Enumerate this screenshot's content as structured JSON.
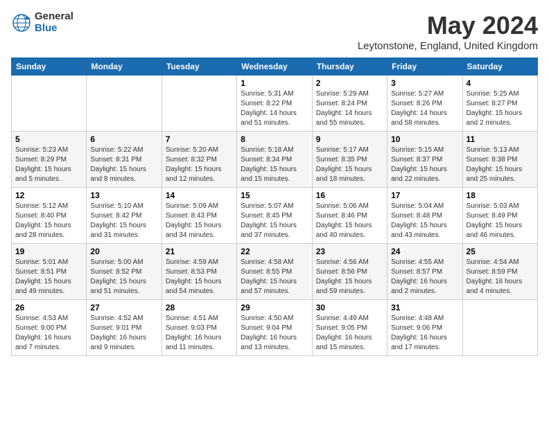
{
  "logo": {
    "general": "General",
    "blue": "Blue"
  },
  "title": {
    "month_year": "May 2024",
    "location": "Leytonstone, England, United Kingdom"
  },
  "headers": [
    "Sunday",
    "Monday",
    "Tuesday",
    "Wednesday",
    "Thursday",
    "Friday",
    "Saturday"
  ],
  "weeks": [
    [
      {
        "day": "",
        "info": ""
      },
      {
        "day": "",
        "info": ""
      },
      {
        "day": "",
        "info": ""
      },
      {
        "day": "1",
        "info": "Sunrise: 5:31 AM\nSunset: 8:22 PM\nDaylight: 14 hours\nand 51 minutes."
      },
      {
        "day": "2",
        "info": "Sunrise: 5:29 AM\nSunset: 8:24 PM\nDaylight: 14 hours\nand 55 minutes."
      },
      {
        "day": "3",
        "info": "Sunrise: 5:27 AM\nSunset: 8:26 PM\nDaylight: 14 hours\nand 58 minutes."
      },
      {
        "day": "4",
        "info": "Sunrise: 5:25 AM\nSunset: 8:27 PM\nDaylight: 15 hours\nand 2 minutes."
      }
    ],
    [
      {
        "day": "5",
        "info": "Sunrise: 5:23 AM\nSunset: 8:29 PM\nDaylight: 15 hours\nand 5 minutes."
      },
      {
        "day": "6",
        "info": "Sunrise: 5:22 AM\nSunset: 8:31 PM\nDaylight: 15 hours\nand 8 minutes."
      },
      {
        "day": "7",
        "info": "Sunrise: 5:20 AM\nSunset: 8:32 PM\nDaylight: 15 hours\nand 12 minutes."
      },
      {
        "day": "8",
        "info": "Sunrise: 5:18 AM\nSunset: 8:34 PM\nDaylight: 15 hours\nand 15 minutes."
      },
      {
        "day": "9",
        "info": "Sunrise: 5:17 AM\nSunset: 8:35 PM\nDaylight: 15 hours\nand 18 minutes."
      },
      {
        "day": "10",
        "info": "Sunrise: 5:15 AM\nSunset: 8:37 PM\nDaylight: 15 hours\nand 22 minutes."
      },
      {
        "day": "11",
        "info": "Sunrise: 5:13 AM\nSunset: 8:38 PM\nDaylight: 15 hours\nand 25 minutes."
      }
    ],
    [
      {
        "day": "12",
        "info": "Sunrise: 5:12 AM\nSunset: 8:40 PM\nDaylight: 15 hours\nand 28 minutes."
      },
      {
        "day": "13",
        "info": "Sunrise: 5:10 AM\nSunset: 8:42 PM\nDaylight: 15 hours\nand 31 minutes."
      },
      {
        "day": "14",
        "info": "Sunrise: 5:09 AM\nSunset: 8:43 PM\nDaylight: 15 hours\nand 34 minutes."
      },
      {
        "day": "15",
        "info": "Sunrise: 5:07 AM\nSunset: 8:45 PM\nDaylight: 15 hours\nand 37 minutes."
      },
      {
        "day": "16",
        "info": "Sunrise: 5:06 AM\nSunset: 8:46 PM\nDaylight: 15 hours\nand 40 minutes."
      },
      {
        "day": "17",
        "info": "Sunrise: 5:04 AM\nSunset: 8:48 PM\nDaylight: 15 hours\nand 43 minutes."
      },
      {
        "day": "18",
        "info": "Sunrise: 5:03 AM\nSunset: 8:49 PM\nDaylight: 15 hours\nand 46 minutes."
      }
    ],
    [
      {
        "day": "19",
        "info": "Sunrise: 5:01 AM\nSunset: 8:51 PM\nDaylight: 15 hours\nand 49 minutes."
      },
      {
        "day": "20",
        "info": "Sunrise: 5:00 AM\nSunset: 8:52 PM\nDaylight: 15 hours\nand 51 minutes."
      },
      {
        "day": "21",
        "info": "Sunrise: 4:59 AM\nSunset: 8:53 PM\nDaylight: 15 hours\nand 54 minutes."
      },
      {
        "day": "22",
        "info": "Sunrise: 4:58 AM\nSunset: 8:55 PM\nDaylight: 15 hours\nand 57 minutes."
      },
      {
        "day": "23",
        "info": "Sunrise: 4:56 AM\nSunset: 8:56 PM\nDaylight: 15 hours\nand 59 minutes."
      },
      {
        "day": "24",
        "info": "Sunrise: 4:55 AM\nSunset: 8:57 PM\nDaylight: 16 hours\nand 2 minutes."
      },
      {
        "day": "25",
        "info": "Sunrise: 4:54 AM\nSunset: 8:59 PM\nDaylight: 16 hours\nand 4 minutes."
      }
    ],
    [
      {
        "day": "26",
        "info": "Sunrise: 4:53 AM\nSunset: 9:00 PM\nDaylight: 16 hours\nand 7 minutes."
      },
      {
        "day": "27",
        "info": "Sunrise: 4:52 AM\nSunset: 9:01 PM\nDaylight: 16 hours\nand 9 minutes."
      },
      {
        "day": "28",
        "info": "Sunrise: 4:51 AM\nSunset: 9:03 PM\nDaylight: 16 hours\nand 11 minutes."
      },
      {
        "day": "29",
        "info": "Sunrise: 4:50 AM\nSunset: 9:04 PM\nDaylight: 16 hours\nand 13 minutes."
      },
      {
        "day": "30",
        "info": "Sunrise: 4:49 AM\nSunset: 9:05 PM\nDaylight: 16 hours\nand 15 minutes."
      },
      {
        "day": "31",
        "info": "Sunrise: 4:48 AM\nSunset: 9:06 PM\nDaylight: 16 hours\nand 17 minutes."
      },
      {
        "day": "",
        "info": ""
      }
    ]
  ]
}
